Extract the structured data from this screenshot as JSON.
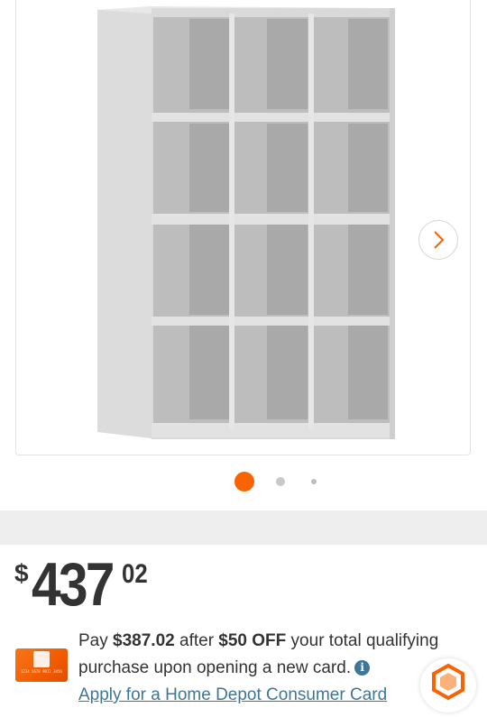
{
  "gallery": {
    "image_alt": "Gray metal 12-cubby storage cabinet",
    "next_icon": "chevron-right-icon",
    "dots": [
      {
        "state": "active",
        "color": "#f96302"
      },
      {
        "state": "inactive",
        "color": "#c8c8c8"
      },
      {
        "state": "inactive",
        "color": "#bdbdbd"
      }
    ]
  },
  "price": {
    "symbol": "$",
    "dollars": "437",
    "cents": "02"
  },
  "promo": {
    "card_number_text": "1234 5678 9012 3456",
    "text_pay": "Pay ",
    "discounted_price": "$387.02",
    "text_after": " after ",
    "discount": "$50 OFF",
    "text_rest": " your total qualifying purchase upon opening a new card.",
    "info_icon": "info-icon",
    "info_glyph": "i",
    "apply_link": "Apply for a Home Depot Consumer Card"
  },
  "colors": {
    "brand_orange": "#f96302",
    "link_blue": "#3e7697",
    "text": "#333333",
    "band": "#eeeeee"
  }
}
